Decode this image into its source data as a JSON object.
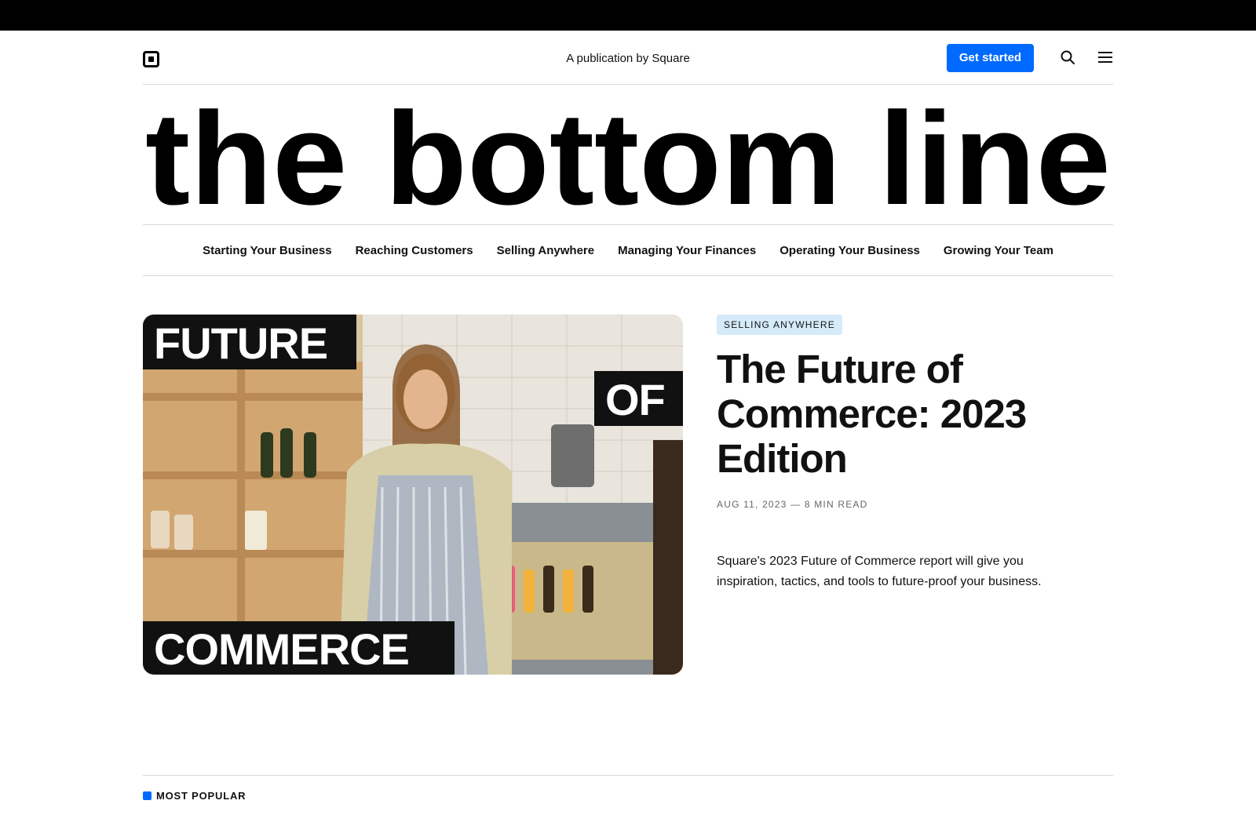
{
  "header": {
    "publication": "A publication by Square",
    "cta_label": "Get started",
    "logo_icon": "square-logo-icon",
    "search_icon": "search-icon",
    "menu_icon": "hamburger-menu-icon"
  },
  "masthead": {
    "title": "the bottom line"
  },
  "nav": {
    "items": [
      {
        "label": "Starting Your Business"
      },
      {
        "label": "Reaching Customers"
      },
      {
        "label": "Selling Anywhere"
      },
      {
        "label": "Managing Your Finances"
      },
      {
        "label": "Operating Your Business"
      },
      {
        "label": "Growing Your Team"
      }
    ]
  },
  "feature": {
    "image_words": [
      "FUTURE",
      "OF",
      "COMMERCE"
    ],
    "tag": "SELLING ANYWHERE",
    "title": "The Future of Commerce: 2023 Edition",
    "meta": "AUG 11, 2023 — 8 MIN READ",
    "summary": "Square's 2023 Future of Commerce report will give you inspiration, tactics, and tools to future-proof your business."
  },
  "section": {
    "label": "MOST POPULAR"
  },
  "colors": {
    "accent": "#006aff",
    "tag_bg": "#d6ebfa",
    "text": "#111111",
    "rule": "#d9d9d9"
  }
}
